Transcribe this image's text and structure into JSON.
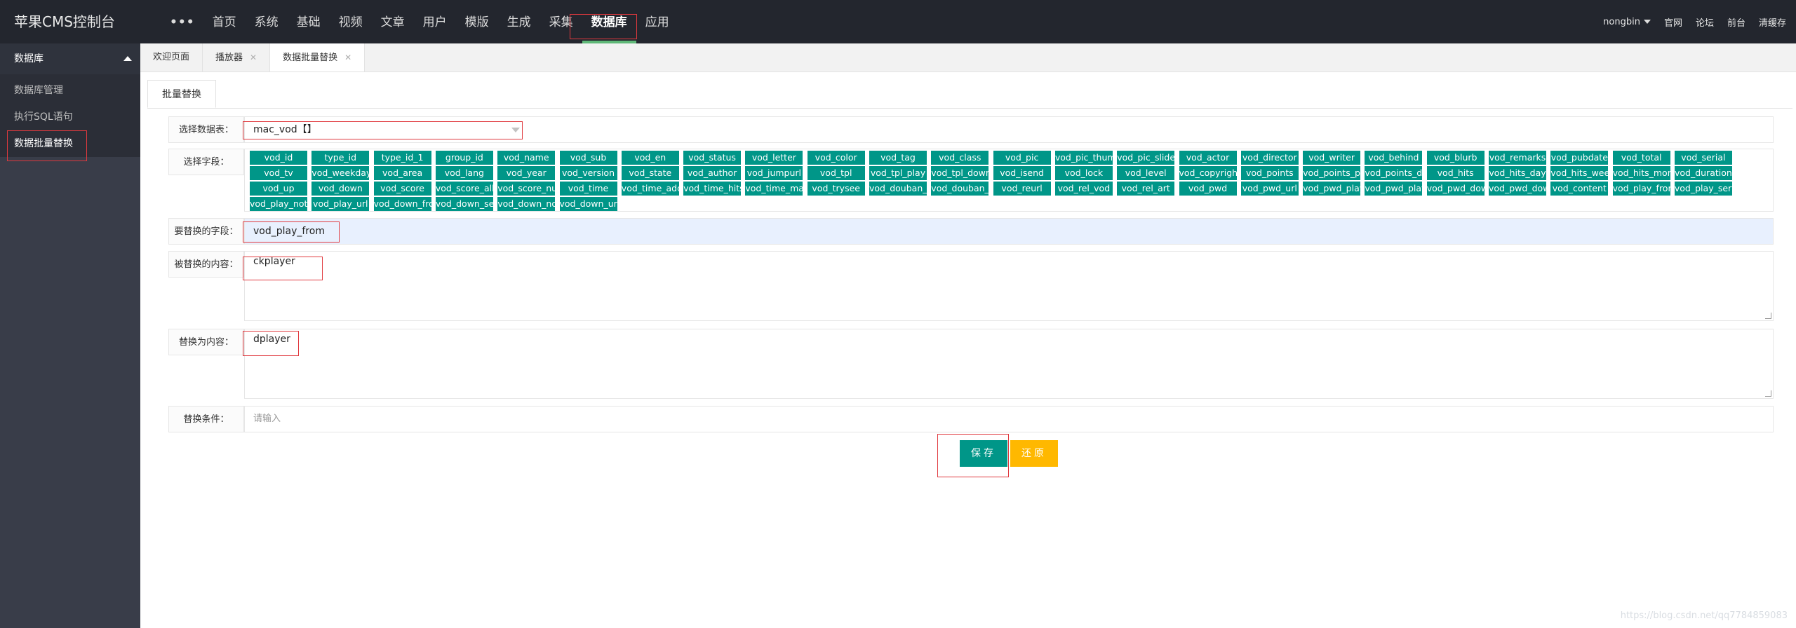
{
  "app": {
    "title": "苹果CMS控制台"
  },
  "topnav": {
    "items": [
      {
        "label": "•••"
      },
      {
        "label": "首页"
      },
      {
        "label": "系统"
      },
      {
        "label": "基础"
      },
      {
        "label": "视频"
      },
      {
        "label": "文章"
      },
      {
        "label": "用户"
      },
      {
        "label": "模版"
      },
      {
        "label": "生成"
      },
      {
        "label": "采集"
      },
      {
        "label": "数据库"
      },
      {
        "label": "应用"
      }
    ],
    "active": "数据库"
  },
  "user_nav": {
    "username": "nongbin",
    "links": [
      "官网",
      "论坛",
      "前台",
      "清缓存"
    ]
  },
  "sidebar": {
    "title": "数据库",
    "items": [
      {
        "label": "数据库管理"
      },
      {
        "label": "执行SQL语句"
      },
      {
        "label": "数据批量替换"
      }
    ]
  },
  "tabs": [
    {
      "label": "欢迎页面",
      "close": ""
    },
    {
      "label": "播放器",
      "close": "✕"
    },
    {
      "label": "数据批量替换",
      "close": "✕"
    }
  ],
  "inner_tab": {
    "label": "批量替换"
  },
  "form": {
    "table_label": "选择数据表：",
    "table_value": "mac_vod【】",
    "fields_label": "选择字段：",
    "fields": [
      "vod_id",
      "type_id",
      "type_id_1",
      "group_id",
      "vod_name",
      "vod_sub",
      "vod_en",
      "vod_status",
      "vod_letter",
      "vod_color",
      "vod_tag",
      "vod_class",
      "vod_pic",
      "vod_pic_thumb",
      "vod_pic_slide",
      "vod_actor",
      "vod_director",
      "vod_writer",
      "vod_behind",
      "vod_blurb",
      "vod_remarks",
      "vod_pubdate",
      "vod_total",
      "vod_serial",
      "vod_tv",
      "vod_weekday",
      "vod_area",
      "vod_lang",
      "vod_year",
      "vod_version",
      "vod_state",
      "vod_author",
      "vod_jumpurl",
      "vod_tpl",
      "vod_tpl_play",
      "vod_tpl_down",
      "vod_isend",
      "vod_lock",
      "vod_level",
      "vod_copyright",
      "vod_points",
      "vod_points_play",
      "vod_points_down",
      "vod_hits",
      "vod_hits_day",
      "vod_hits_week",
      "vod_hits_month",
      "vod_duration",
      "vod_up",
      "vod_down",
      "vod_score",
      "vod_score_all",
      "vod_score_num",
      "vod_time",
      "vod_time_add",
      "vod_time_hits",
      "vod_time_make",
      "vod_trysee",
      "vod_douban_id",
      "vod_douban_score",
      "vod_reurl",
      "vod_rel_vod",
      "vod_rel_art",
      "vod_pwd",
      "vod_pwd_url",
      "vod_pwd_play",
      "vod_pwd_play_url",
      "vod_pwd_down",
      "vod_pwd_down_url",
      "vod_content",
      "vod_play_from",
      "vod_play_server",
      "vod_play_note",
      "vod_play_url",
      "vod_down_from",
      "vod_down_server",
      "vod_down_note",
      "vod_down_url"
    ],
    "replace_field_label": "要替换的字段：",
    "replace_field_value": "vod_play_from",
    "search_label": "被替换的内容：",
    "search_value": "ckplayer",
    "replace_label": "替换为内容：",
    "replace_value": "dplayer",
    "condition_label": "替换条件：",
    "condition_placeholder": "请输入"
  },
  "buttons": {
    "save": "保存",
    "reset": "还原"
  },
  "watermark": "https://blog.csdn.net/qq7784859083",
  "colors": {
    "topbar": "#23262e",
    "sidebar": "#393d49",
    "field_button": "#009688",
    "reset_button": "#ffb800",
    "highlight": "#e0393e"
  }
}
